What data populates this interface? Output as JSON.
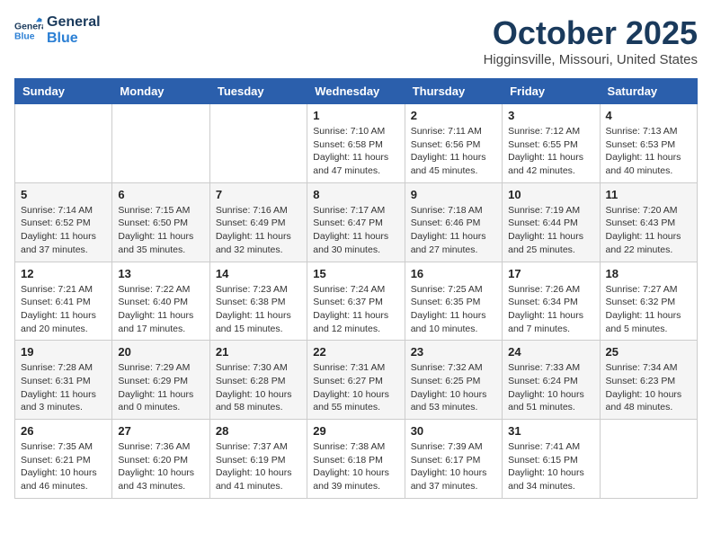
{
  "header": {
    "logo_line1": "General",
    "logo_line2": "Blue",
    "month": "October 2025",
    "location": "Higginsville, Missouri, United States"
  },
  "weekdays": [
    "Sunday",
    "Monday",
    "Tuesday",
    "Wednesday",
    "Thursday",
    "Friday",
    "Saturday"
  ],
  "weeks": [
    [
      {
        "day": "",
        "info": ""
      },
      {
        "day": "",
        "info": ""
      },
      {
        "day": "",
        "info": ""
      },
      {
        "day": "1",
        "info": "Sunrise: 7:10 AM\nSunset: 6:58 PM\nDaylight: 11 hours and 47 minutes."
      },
      {
        "day": "2",
        "info": "Sunrise: 7:11 AM\nSunset: 6:56 PM\nDaylight: 11 hours and 45 minutes."
      },
      {
        "day": "3",
        "info": "Sunrise: 7:12 AM\nSunset: 6:55 PM\nDaylight: 11 hours and 42 minutes."
      },
      {
        "day": "4",
        "info": "Sunrise: 7:13 AM\nSunset: 6:53 PM\nDaylight: 11 hours and 40 minutes."
      }
    ],
    [
      {
        "day": "5",
        "info": "Sunrise: 7:14 AM\nSunset: 6:52 PM\nDaylight: 11 hours and 37 minutes."
      },
      {
        "day": "6",
        "info": "Sunrise: 7:15 AM\nSunset: 6:50 PM\nDaylight: 11 hours and 35 minutes."
      },
      {
        "day": "7",
        "info": "Sunrise: 7:16 AM\nSunset: 6:49 PM\nDaylight: 11 hours and 32 minutes."
      },
      {
        "day": "8",
        "info": "Sunrise: 7:17 AM\nSunset: 6:47 PM\nDaylight: 11 hours and 30 minutes."
      },
      {
        "day": "9",
        "info": "Sunrise: 7:18 AM\nSunset: 6:46 PM\nDaylight: 11 hours and 27 minutes."
      },
      {
        "day": "10",
        "info": "Sunrise: 7:19 AM\nSunset: 6:44 PM\nDaylight: 11 hours and 25 minutes."
      },
      {
        "day": "11",
        "info": "Sunrise: 7:20 AM\nSunset: 6:43 PM\nDaylight: 11 hours and 22 minutes."
      }
    ],
    [
      {
        "day": "12",
        "info": "Sunrise: 7:21 AM\nSunset: 6:41 PM\nDaylight: 11 hours and 20 minutes."
      },
      {
        "day": "13",
        "info": "Sunrise: 7:22 AM\nSunset: 6:40 PM\nDaylight: 11 hours and 17 minutes."
      },
      {
        "day": "14",
        "info": "Sunrise: 7:23 AM\nSunset: 6:38 PM\nDaylight: 11 hours and 15 minutes."
      },
      {
        "day": "15",
        "info": "Sunrise: 7:24 AM\nSunset: 6:37 PM\nDaylight: 11 hours and 12 minutes."
      },
      {
        "day": "16",
        "info": "Sunrise: 7:25 AM\nSunset: 6:35 PM\nDaylight: 11 hours and 10 minutes."
      },
      {
        "day": "17",
        "info": "Sunrise: 7:26 AM\nSunset: 6:34 PM\nDaylight: 11 hours and 7 minutes."
      },
      {
        "day": "18",
        "info": "Sunrise: 7:27 AM\nSunset: 6:32 PM\nDaylight: 11 hours and 5 minutes."
      }
    ],
    [
      {
        "day": "19",
        "info": "Sunrise: 7:28 AM\nSunset: 6:31 PM\nDaylight: 11 hours and 3 minutes."
      },
      {
        "day": "20",
        "info": "Sunrise: 7:29 AM\nSunset: 6:29 PM\nDaylight: 11 hours and 0 minutes."
      },
      {
        "day": "21",
        "info": "Sunrise: 7:30 AM\nSunset: 6:28 PM\nDaylight: 10 hours and 58 minutes."
      },
      {
        "day": "22",
        "info": "Sunrise: 7:31 AM\nSunset: 6:27 PM\nDaylight: 10 hours and 55 minutes."
      },
      {
        "day": "23",
        "info": "Sunrise: 7:32 AM\nSunset: 6:25 PM\nDaylight: 10 hours and 53 minutes."
      },
      {
        "day": "24",
        "info": "Sunrise: 7:33 AM\nSunset: 6:24 PM\nDaylight: 10 hours and 51 minutes."
      },
      {
        "day": "25",
        "info": "Sunrise: 7:34 AM\nSunset: 6:23 PM\nDaylight: 10 hours and 48 minutes."
      }
    ],
    [
      {
        "day": "26",
        "info": "Sunrise: 7:35 AM\nSunset: 6:21 PM\nDaylight: 10 hours and 46 minutes."
      },
      {
        "day": "27",
        "info": "Sunrise: 7:36 AM\nSunset: 6:20 PM\nDaylight: 10 hours and 43 minutes."
      },
      {
        "day": "28",
        "info": "Sunrise: 7:37 AM\nSunset: 6:19 PM\nDaylight: 10 hours and 41 minutes."
      },
      {
        "day": "29",
        "info": "Sunrise: 7:38 AM\nSunset: 6:18 PM\nDaylight: 10 hours and 39 minutes."
      },
      {
        "day": "30",
        "info": "Sunrise: 7:39 AM\nSunset: 6:17 PM\nDaylight: 10 hours and 37 minutes."
      },
      {
        "day": "31",
        "info": "Sunrise: 7:41 AM\nSunset: 6:15 PM\nDaylight: 10 hours and 34 minutes."
      },
      {
        "day": "",
        "info": ""
      }
    ]
  ]
}
